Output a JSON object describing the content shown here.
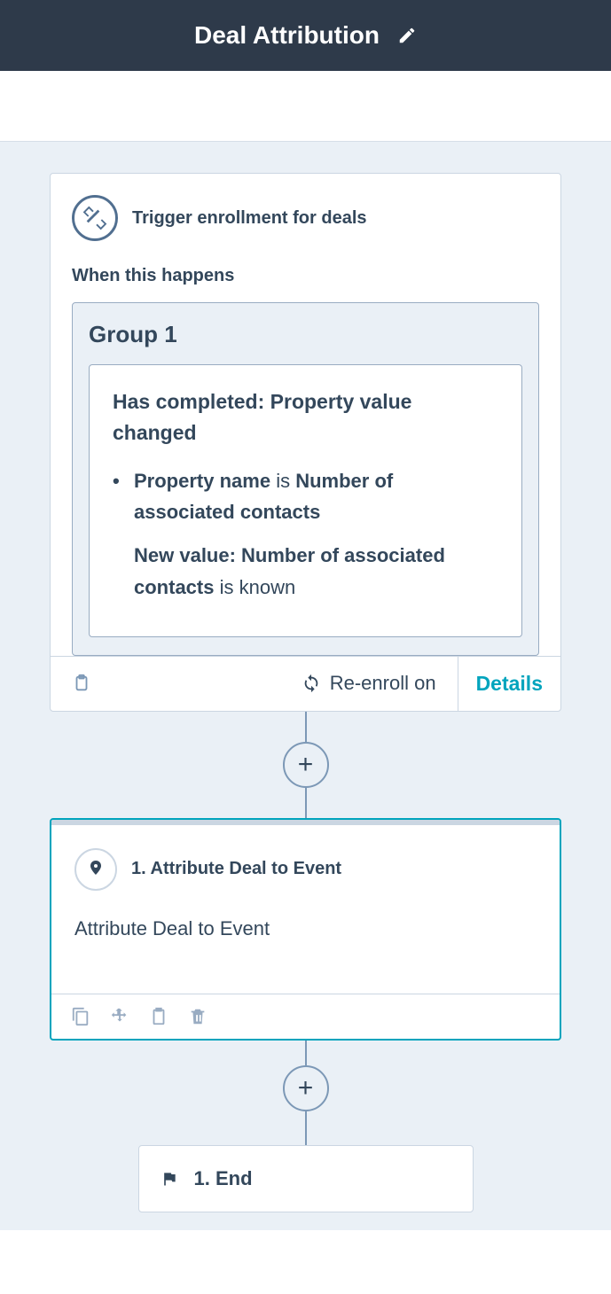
{
  "header": {
    "title": "Deal Attribution"
  },
  "trigger": {
    "title": "Trigger enrollment for deals",
    "when_label": "When this happens",
    "group_title": "Group 1",
    "condition_title": "Has completed: Property value changed",
    "cond1_prefix": "Property name",
    "cond1_is": "is",
    "cond1_value": "Number of associated contacts",
    "cond2_prefix": "New value: Number of associated contacts",
    "cond2_is": "is known",
    "reenroll_label": "Re-enroll on",
    "details_label": "Details"
  },
  "action": {
    "title": "1. Attribute Deal to Event",
    "description": "Attribute Deal to Event"
  },
  "end": {
    "label": "1. End"
  },
  "colors": {
    "header_bg": "#2e3a4a",
    "canvas_bg": "#eaf0f6",
    "accent": "#00a4bd",
    "text": "#33475b",
    "muted": "#7c98b6"
  }
}
